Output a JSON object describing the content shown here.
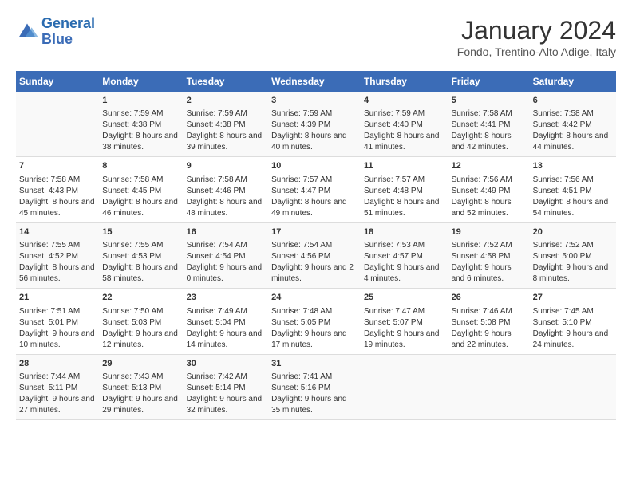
{
  "logo": {
    "line1": "General",
    "line2": "Blue"
  },
  "title": "January 2024",
  "subtitle": "Fondo, Trentino-Alto Adige, Italy",
  "headers": [
    "Sunday",
    "Monday",
    "Tuesday",
    "Wednesday",
    "Thursday",
    "Friday",
    "Saturday"
  ],
  "weeks": [
    [
      {
        "day": "",
        "sunrise": "",
        "sunset": "",
        "daylight": ""
      },
      {
        "day": "1",
        "sunrise": "Sunrise: 7:59 AM",
        "sunset": "Sunset: 4:38 PM",
        "daylight": "Daylight: 8 hours and 38 minutes."
      },
      {
        "day": "2",
        "sunrise": "Sunrise: 7:59 AM",
        "sunset": "Sunset: 4:38 PM",
        "daylight": "Daylight: 8 hours and 39 minutes."
      },
      {
        "day": "3",
        "sunrise": "Sunrise: 7:59 AM",
        "sunset": "Sunset: 4:39 PM",
        "daylight": "Daylight: 8 hours and 40 minutes."
      },
      {
        "day": "4",
        "sunrise": "Sunrise: 7:59 AM",
        "sunset": "Sunset: 4:40 PM",
        "daylight": "Daylight: 8 hours and 41 minutes."
      },
      {
        "day": "5",
        "sunrise": "Sunrise: 7:58 AM",
        "sunset": "Sunset: 4:41 PM",
        "daylight": "Daylight: 8 hours and 42 minutes."
      },
      {
        "day": "6",
        "sunrise": "Sunrise: 7:58 AM",
        "sunset": "Sunset: 4:42 PM",
        "daylight": "Daylight: 8 hours and 44 minutes."
      }
    ],
    [
      {
        "day": "7",
        "sunrise": "Sunrise: 7:58 AM",
        "sunset": "Sunset: 4:43 PM",
        "daylight": "Daylight: 8 hours and 45 minutes."
      },
      {
        "day": "8",
        "sunrise": "Sunrise: 7:58 AM",
        "sunset": "Sunset: 4:45 PM",
        "daylight": "Daylight: 8 hours and 46 minutes."
      },
      {
        "day": "9",
        "sunrise": "Sunrise: 7:58 AM",
        "sunset": "Sunset: 4:46 PM",
        "daylight": "Daylight: 8 hours and 48 minutes."
      },
      {
        "day": "10",
        "sunrise": "Sunrise: 7:57 AM",
        "sunset": "Sunset: 4:47 PM",
        "daylight": "Daylight: 8 hours and 49 minutes."
      },
      {
        "day": "11",
        "sunrise": "Sunrise: 7:57 AM",
        "sunset": "Sunset: 4:48 PM",
        "daylight": "Daylight: 8 hours and 51 minutes."
      },
      {
        "day": "12",
        "sunrise": "Sunrise: 7:56 AM",
        "sunset": "Sunset: 4:49 PM",
        "daylight": "Daylight: 8 hours and 52 minutes."
      },
      {
        "day": "13",
        "sunrise": "Sunrise: 7:56 AM",
        "sunset": "Sunset: 4:51 PM",
        "daylight": "Daylight: 8 hours and 54 minutes."
      }
    ],
    [
      {
        "day": "14",
        "sunrise": "Sunrise: 7:55 AM",
        "sunset": "Sunset: 4:52 PM",
        "daylight": "Daylight: 8 hours and 56 minutes."
      },
      {
        "day": "15",
        "sunrise": "Sunrise: 7:55 AM",
        "sunset": "Sunset: 4:53 PM",
        "daylight": "Daylight: 8 hours and 58 minutes."
      },
      {
        "day": "16",
        "sunrise": "Sunrise: 7:54 AM",
        "sunset": "Sunset: 4:54 PM",
        "daylight": "Daylight: 9 hours and 0 minutes."
      },
      {
        "day": "17",
        "sunrise": "Sunrise: 7:54 AM",
        "sunset": "Sunset: 4:56 PM",
        "daylight": "Daylight: 9 hours and 2 minutes."
      },
      {
        "day": "18",
        "sunrise": "Sunrise: 7:53 AM",
        "sunset": "Sunset: 4:57 PM",
        "daylight": "Daylight: 9 hours and 4 minutes."
      },
      {
        "day": "19",
        "sunrise": "Sunrise: 7:52 AM",
        "sunset": "Sunset: 4:58 PM",
        "daylight": "Daylight: 9 hours and 6 minutes."
      },
      {
        "day": "20",
        "sunrise": "Sunrise: 7:52 AM",
        "sunset": "Sunset: 5:00 PM",
        "daylight": "Daylight: 9 hours and 8 minutes."
      }
    ],
    [
      {
        "day": "21",
        "sunrise": "Sunrise: 7:51 AM",
        "sunset": "Sunset: 5:01 PM",
        "daylight": "Daylight: 9 hours and 10 minutes."
      },
      {
        "day": "22",
        "sunrise": "Sunrise: 7:50 AM",
        "sunset": "Sunset: 5:03 PM",
        "daylight": "Daylight: 9 hours and 12 minutes."
      },
      {
        "day": "23",
        "sunrise": "Sunrise: 7:49 AM",
        "sunset": "Sunset: 5:04 PM",
        "daylight": "Daylight: 9 hours and 14 minutes."
      },
      {
        "day": "24",
        "sunrise": "Sunrise: 7:48 AM",
        "sunset": "Sunset: 5:05 PM",
        "daylight": "Daylight: 9 hours and 17 minutes."
      },
      {
        "day": "25",
        "sunrise": "Sunrise: 7:47 AM",
        "sunset": "Sunset: 5:07 PM",
        "daylight": "Daylight: 9 hours and 19 minutes."
      },
      {
        "day": "26",
        "sunrise": "Sunrise: 7:46 AM",
        "sunset": "Sunset: 5:08 PM",
        "daylight": "Daylight: 9 hours and 22 minutes."
      },
      {
        "day": "27",
        "sunrise": "Sunrise: 7:45 AM",
        "sunset": "Sunset: 5:10 PM",
        "daylight": "Daylight: 9 hours and 24 minutes."
      }
    ],
    [
      {
        "day": "28",
        "sunrise": "Sunrise: 7:44 AM",
        "sunset": "Sunset: 5:11 PM",
        "daylight": "Daylight: 9 hours and 27 minutes."
      },
      {
        "day": "29",
        "sunrise": "Sunrise: 7:43 AM",
        "sunset": "Sunset: 5:13 PM",
        "daylight": "Daylight: 9 hours and 29 minutes."
      },
      {
        "day": "30",
        "sunrise": "Sunrise: 7:42 AM",
        "sunset": "Sunset: 5:14 PM",
        "daylight": "Daylight: 9 hours and 32 minutes."
      },
      {
        "day": "31",
        "sunrise": "Sunrise: 7:41 AM",
        "sunset": "Sunset: 5:16 PM",
        "daylight": "Daylight: 9 hours and 35 minutes."
      },
      {
        "day": "",
        "sunrise": "",
        "sunset": "",
        "daylight": ""
      },
      {
        "day": "",
        "sunrise": "",
        "sunset": "",
        "daylight": ""
      },
      {
        "day": "",
        "sunrise": "",
        "sunset": "",
        "daylight": ""
      }
    ]
  ]
}
